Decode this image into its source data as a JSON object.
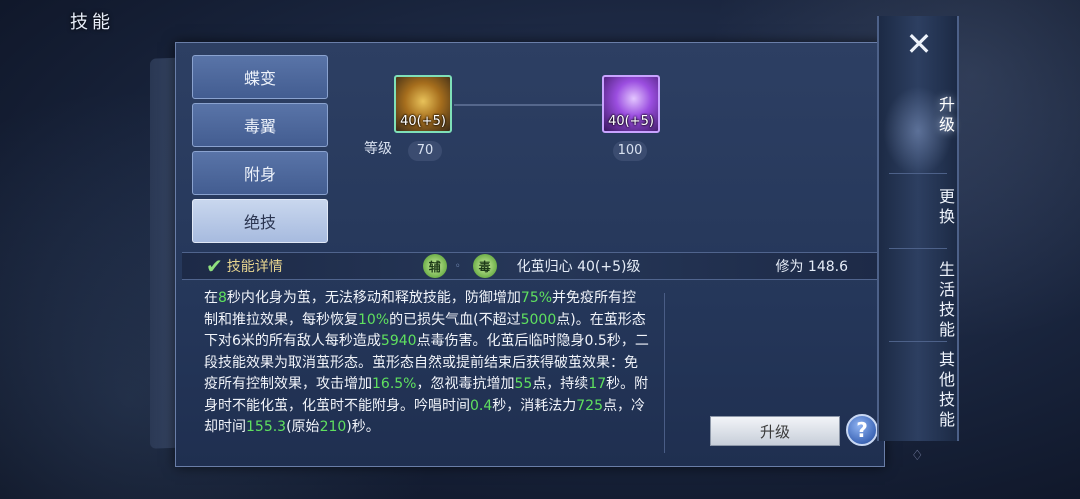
{
  "window": {
    "title": "技能"
  },
  "tabs": [
    "蝶变",
    "毒翼",
    "附身",
    "绝技"
  ],
  "skills": [
    {
      "level_badge": "40(+5)",
      "icon": "golden-cocoon-icon"
    },
    {
      "level_badge": "40(+5)",
      "icon": "purple-spark-icon"
    }
  ],
  "level_caption": "等级",
  "levels": [
    "70",
    "100"
  ],
  "info_bar": {
    "title": "技能详情",
    "type1": "辅",
    "type2": "毒",
    "skill_name": "化茧归心 40(+5)级",
    "cultivation": "修为   148.6"
  },
  "description": {
    "p1": "在",
    "n1": "8",
    "p2": "秒内化身为茧，无法移动和释放技能，防御增加",
    "n2": "75%",
    "p3": "并免疫所有控制和推拉效果，每秒恢复",
    "n3": "10%",
    "p4": "的已损失气血(不超过",
    "n4": "5000",
    "p5": "点)。在茧形态下对6米的所有敌人每秒造成",
    "n5": "5940",
    "p6": "点毒伤害。化茧后临时隐身0.5秒，二段技能效果为取消茧形态。茧形态自然或提前结束后获得破茧效果：免疫所有控制效果，攻击增加",
    "n6": "16.5%",
    "p7": "，忽视毒抗增加",
    "n7": "55",
    "p8": "点，持续",
    "n8": "17",
    "p9": "秒。附身时不能化茧，化茧时不能附身。吟唱时间",
    "n9": "0.4",
    "p10": "秒，消耗法力",
    "n10": "725",
    "p11": "点，冷却时间",
    "n11": "155.3",
    "p12": "(原始",
    "n12": "210",
    "p13": ")秒。"
  },
  "upgrade_button": "升级",
  "help_button": "?",
  "side_menu": [
    "升级",
    "更换",
    "生活技能",
    "其他技能"
  ],
  "colors": {
    "highlight": "#5fe05f",
    "accent_title": "#e6d48f"
  }
}
